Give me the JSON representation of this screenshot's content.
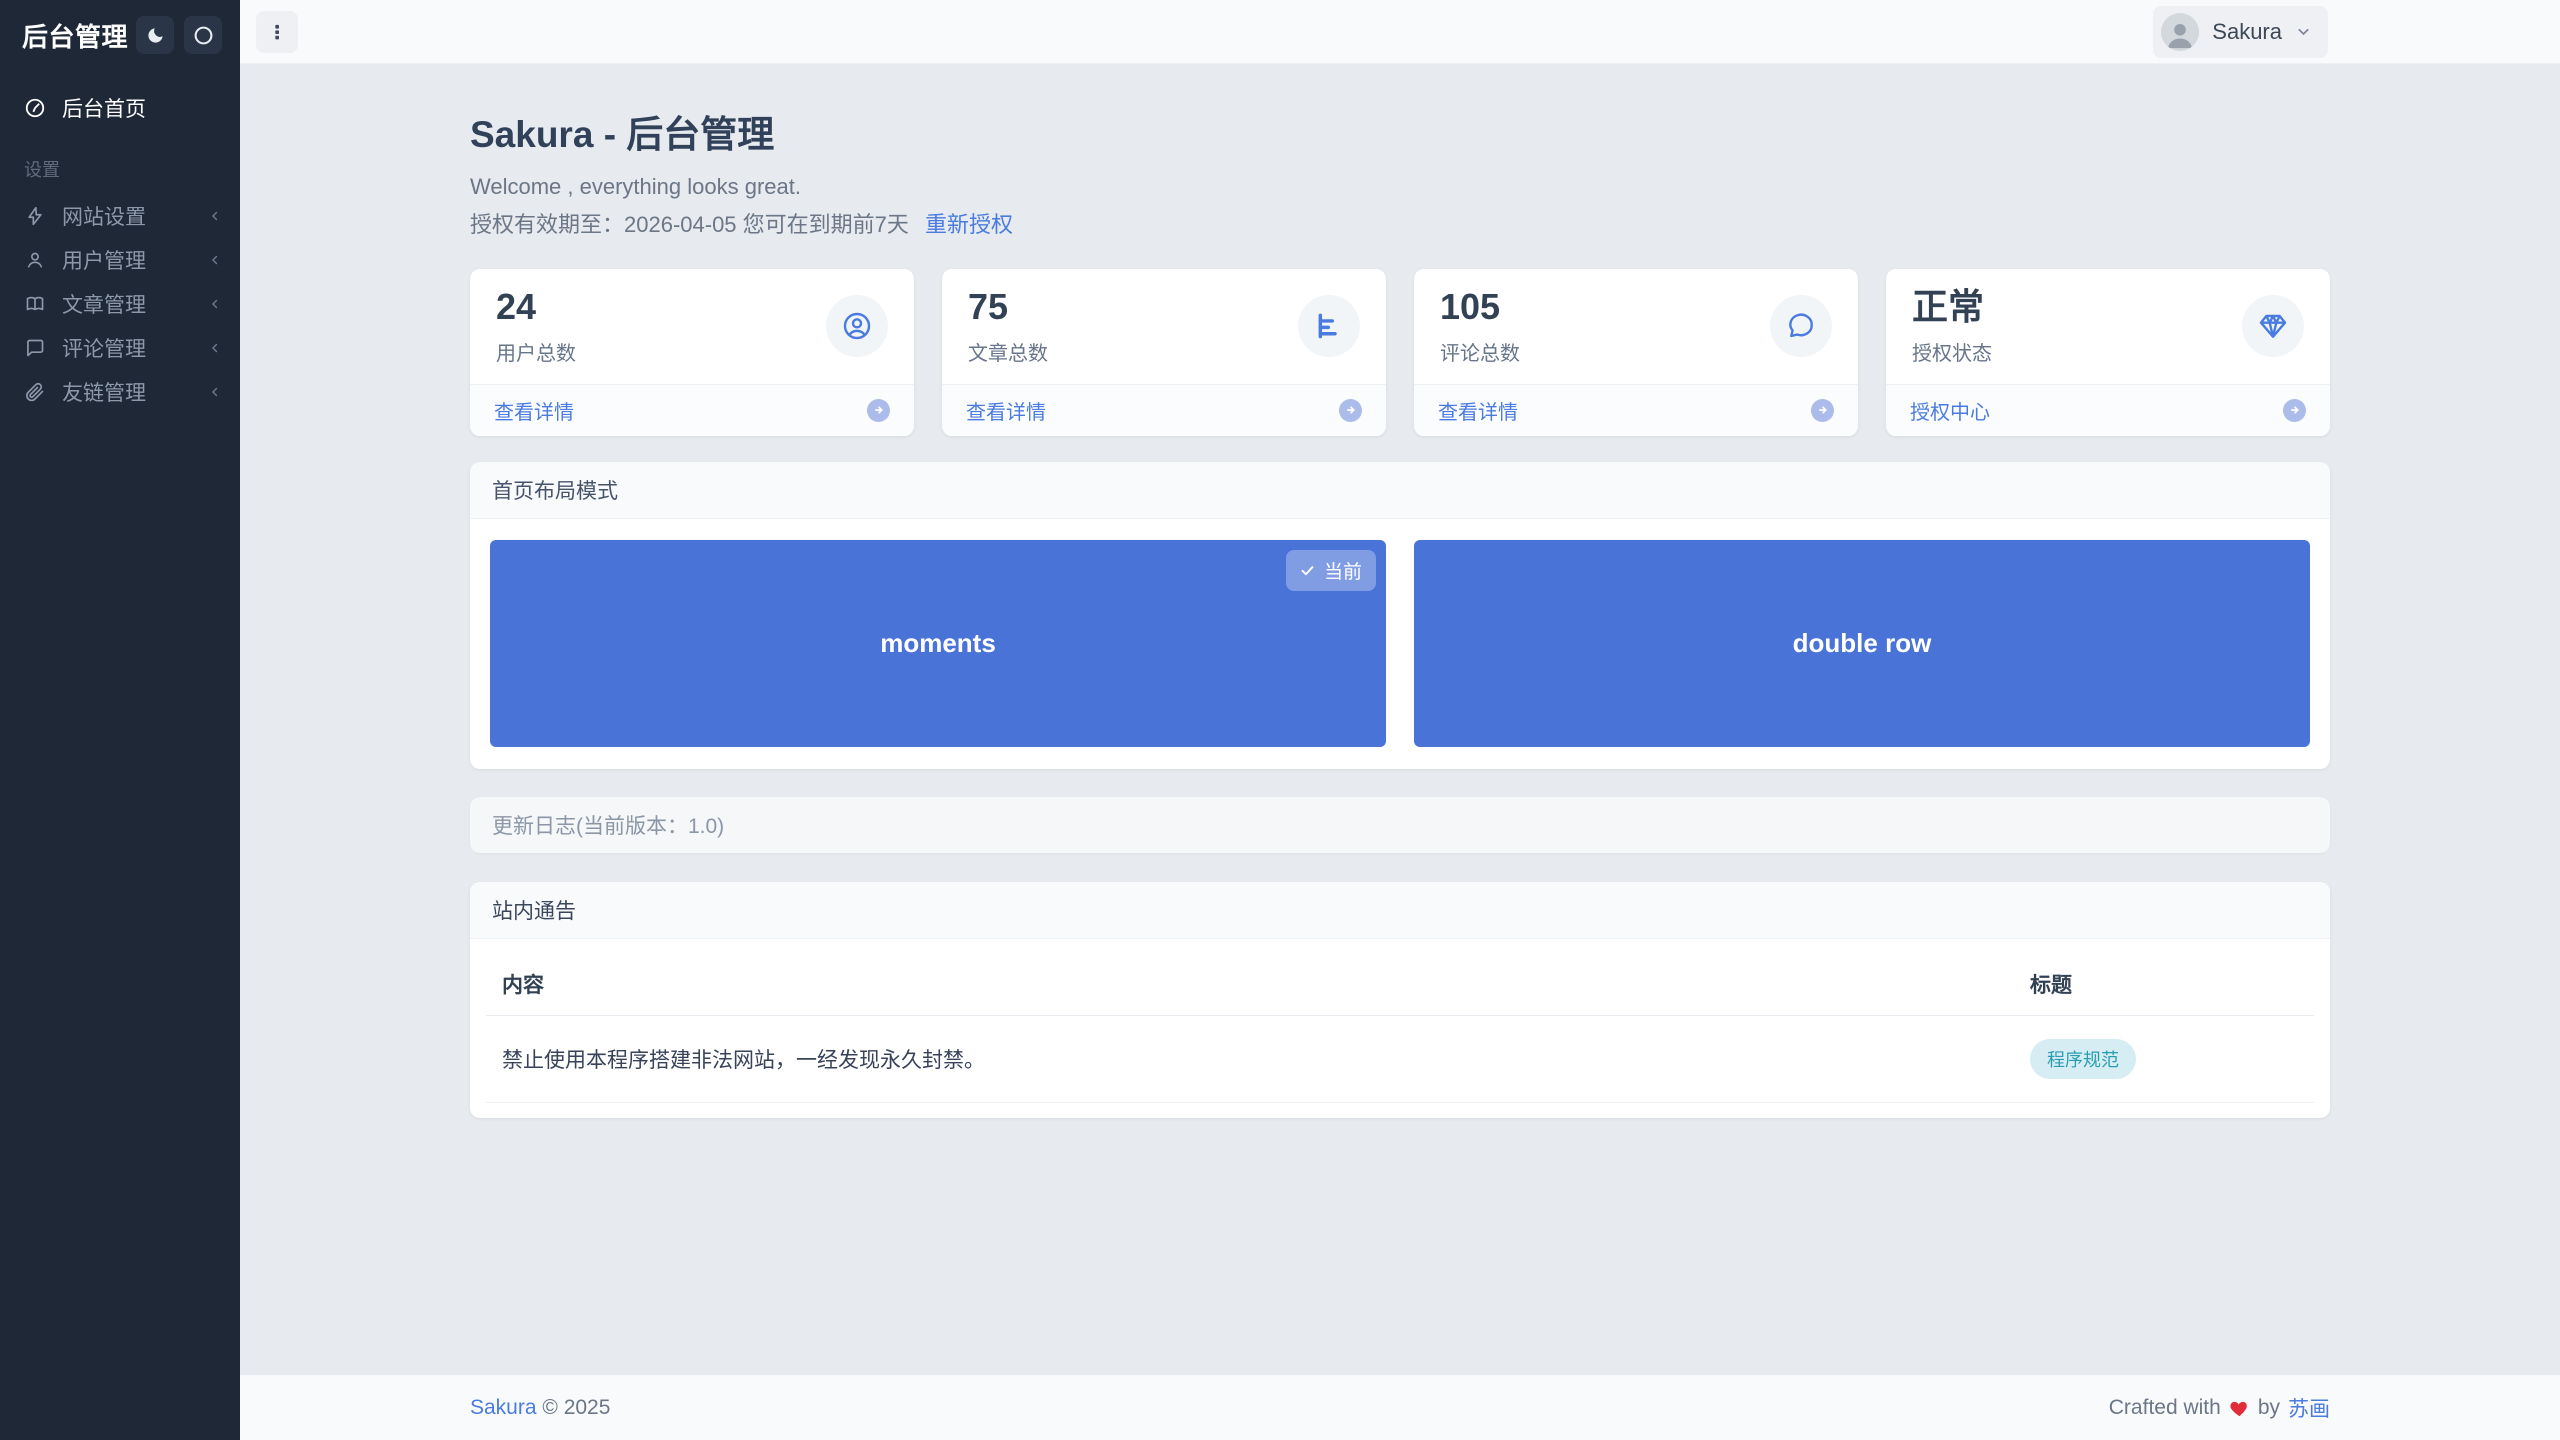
{
  "sidebar": {
    "title": "后台管理",
    "home_label": "后台首页",
    "section_label": "设置",
    "items": [
      {
        "label": "网站设置",
        "icon": "bolt-icon"
      },
      {
        "label": "用户管理",
        "icon": "user-icon"
      },
      {
        "label": "文章管理",
        "icon": "book-icon"
      },
      {
        "label": "评论管理",
        "icon": "comment-icon"
      },
      {
        "label": "友链管理",
        "icon": "paperclip-icon"
      }
    ]
  },
  "topbar": {
    "user_name": "Sakura"
  },
  "header": {
    "title": "Sakura - 后台管理",
    "welcome": "Welcome , everything looks great.",
    "license_text": "授权有效期至：2026-04-05 您可在到期前7天",
    "license_link": "重新授权"
  },
  "stats": [
    {
      "value": "24",
      "label": "用户总数",
      "link": "查看详情",
      "icon": "user-circle-icon"
    },
    {
      "value": "75",
      "label": "文章总数",
      "link": "查看详情",
      "icon": "bar-chart-icon"
    },
    {
      "value": "105",
      "label": "评论总数",
      "link": "查看详情",
      "icon": "comment-bubble-icon"
    },
    {
      "value": "正常",
      "label": "授权状态",
      "link": "授权中心",
      "icon": "gem-icon"
    }
  ],
  "layout": {
    "title": "首页布局模式",
    "current_badge": "当前",
    "options": [
      {
        "label": "moments",
        "current": true
      },
      {
        "label": "double row",
        "current": false
      }
    ]
  },
  "changelog": {
    "label": "更新日志(当前版本：1.0)"
  },
  "notice": {
    "title": "站内通告",
    "columns": [
      "内容",
      "标题"
    ],
    "rows": [
      {
        "content": "禁止使用本程序搭建非法网站，一经发现永久封禁。",
        "tag": "程序规范"
      }
    ]
  },
  "footer": {
    "brand": "Sakura",
    "copyright": "© 2025",
    "crafted_with": "Crafted with",
    "by": "by",
    "author": "苏画"
  },
  "colors": {
    "sidebar_bg": "#1e2836",
    "topbar_bg": "#f9fafb",
    "content_bg": "#e7eaee",
    "footer_bg": "#f8fafb",
    "accent_blue": "#4a7be0",
    "panel_blue": "#4a73d8",
    "tag_bg": "#d5edf3",
    "tag_text": "#2b9db2",
    "heart_red": "#e02d39"
  }
}
